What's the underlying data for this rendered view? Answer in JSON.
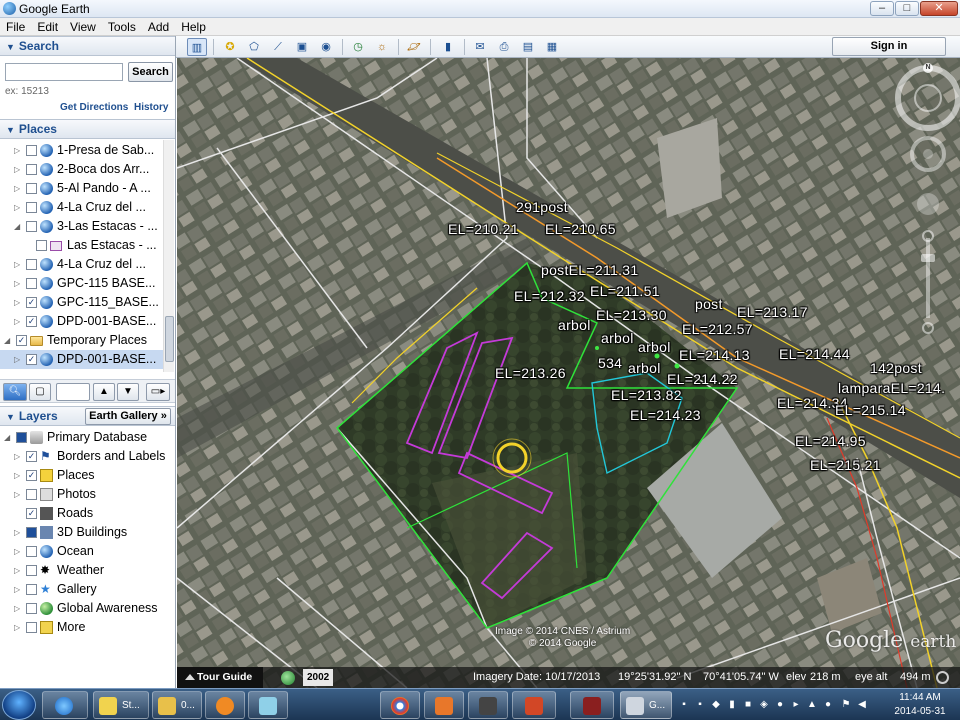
{
  "window": {
    "title": "Google Earth",
    "minimize": "–",
    "maximize": "□",
    "close": "✕"
  },
  "menu": [
    "File",
    "Edit",
    "View",
    "Tools",
    "Add",
    "Help"
  ],
  "search": {
    "header": "Search",
    "input_value": "",
    "button": "Search",
    "hint": "ex: 15213",
    "get_directions": "Get Directions",
    "history": "History"
  },
  "places": {
    "header": "Places",
    "items": [
      {
        "label": "1-Presa de Sab...",
        "icon": "globe-icon",
        "checked": false
      },
      {
        "label": "2-Boca dos Arr...",
        "icon": "globe-icon",
        "checked": false
      },
      {
        "label": "5-Al Pando - A ...",
        "icon": "globe-icon",
        "checked": false
      },
      {
        "label": "4-La Cruz del ...",
        "icon": "globe-icon",
        "checked": false
      },
      {
        "label": "3-Las Estacas - ...",
        "icon": "globe-icon",
        "checked": false
      },
      {
        "label": "Las Estacas - ...",
        "icon": "polygon-icon",
        "checked": false
      },
      {
        "label": "4-La Cruz del ...",
        "icon": "globe-icon",
        "checked": false
      },
      {
        "label": "GPC-115 BASE...",
        "icon": "globe-icon",
        "checked": false
      },
      {
        "label": "GPC-115_BASE...",
        "icon": "globe-icon",
        "checked": true
      },
      {
        "label": "DPD-001-BASE...",
        "icon": "globe-icon",
        "checked": true
      },
      {
        "label": "Temporary Places",
        "icon": "folder-icon",
        "checked": true
      },
      {
        "label": "DPD-001-BASE...",
        "icon": "globe-icon",
        "checked": true
      }
    ]
  },
  "layers": {
    "header": "Layers",
    "gallery_button": "Earth Gallery »",
    "items": [
      {
        "label": "Primary Database",
        "icon": "database-icon",
        "checked": true
      },
      {
        "label": "Borders and Labels",
        "icon": "flag-icon",
        "checked": true
      },
      {
        "label": "Places",
        "icon": "places-icon",
        "checked": true
      },
      {
        "label": "Photos",
        "icon": "photo-icon",
        "checked": false
      },
      {
        "label": "Roads",
        "icon": "road-icon",
        "checked": true
      },
      {
        "label": "3D Buildings",
        "icon": "building-icon",
        "checked": false
      },
      {
        "label": "Ocean",
        "icon": "ocean-icon",
        "checked": false
      },
      {
        "label": "Weather",
        "icon": "weather-icon",
        "checked": false
      },
      {
        "label": "Gallery",
        "icon": "gallery-icon",
        "checked": false
      },
      {
        "label": "Global Awareness",
        "icon": "globe-icon",
        "checked": false
      },
      {
        "label": "More",
        "icon": "more-icon",
        "checked": false
      }
    ]
  },
  "toolbar": {
    "signin": "Sign in"
  },
  "map_labels": [
    "291post",
    "EL=210.21",
    "EL=210.65",
    "postEL=211.31",
    "EL=212.32",
    "EL=211.51",
    "post",
    "EL=213.17",
    "arbol",
    "EL=213.30",
    "EL=212.57",
    "arbol",
    "EL=214.13",
    "EL=214.44",
    "534",
    "arbol",
    "142post",
    "EL=213.26",
    "arbol",
    "EL=214.22",
    "lamparaEL=214.",
    "EL=213.82",
    "EL=214.34",
    "EL=215.14",
    "EL=214.23",
    "EL=214.95",
    "EL=215.21"
  ],
  "compass": "N",
  "copyright": {
    "line1": "Image © 2014 CNES / Astrium",
    "line2": "© 2014 Google"
  },
  "logo": {
    "main": "Google",
    "sub": "earth"
  },
  "status": {
    "tour_guide": "Tour Guide",
    "year": "2002",
    "imagery_date": "Imagery Date: 10/17/2013",
    "lat": "19°25'31.92\" N",
    "lon": "70°41'05.74\" W",
    "elev_label": "elev",
    "elev_value": "218 m",
    "eye_label": "eye alt",
    "eye_value": "494 m"
  },
  "taskbar": {
    "apps": [
      "St...",
      "0...",
      "",
      "",
      "",
      "",
      "",
      "",
      "",
      "G..."
    ],
    "time": "11:44 AM",
    "date": "2014-05-31"
  },
  "colors": {
    "accent": "#1f4f8f",
    "map_boundary_green": "#2fe23a",
    "map_polygon_magenta": "#c43ad8",
    "map_polygon_cyan": "#22c7d8",
    "map_road_yellow": "#f2d22a",
    "map_road_white": "#e8e8e8"
  }
}
